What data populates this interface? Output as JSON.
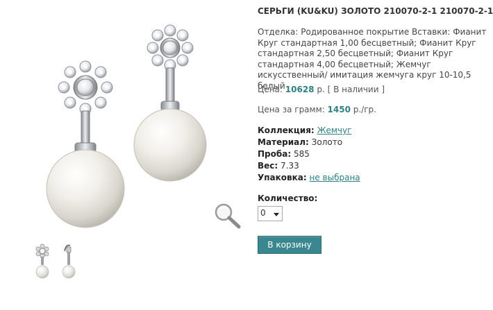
{
  "product": {
    "title": "СЕРЬГИ (KU&KU) ЗОЛОТО 210070-2-1 210070-2-1",
    "description": "Отделка: Родированное покрытие Вставки: Фианит Круг стандартная 1,00 бесцветный; Фианит Круг стандартная 2,50 бесцветный; Фианит Круг стандартная 4,00 бесцветный; Жемчуг искусственный/ имитация жемчуга круг 10-10,5 белый",
    "price_label": "Цена:",
    "price_value": "10628",
    "price_currency": "р.",
    "availability": "[ В наличии ]",
    "gram_price_label": "Цена за грамм:",
    "gram_price_value": "1450",
    "gram_price_unit": "р./гр.",
    "collection_label": "Коллекция:",
    "collection_value": "Жемчуг",
    "material_label": "Материал:",
    "material_value": "Золото",
    "probe_label": "Проба:",
    "probe_value": "585",
    "weight_label": "Вес:",
    "weight_value": "7.33",
    "package_label": "Упаковка:",
    "package_value": "не выбрана",
    "quantity_label": "Количество:",
    "quantity_value": "0",
    "cart_button": "В корзину"
  },
  "colors": {
    "accent": "#2f7f86",
    "button": "#3a8790"
  },
  "icons": {
    "zoom": "magnifier-icon"
  }
}
